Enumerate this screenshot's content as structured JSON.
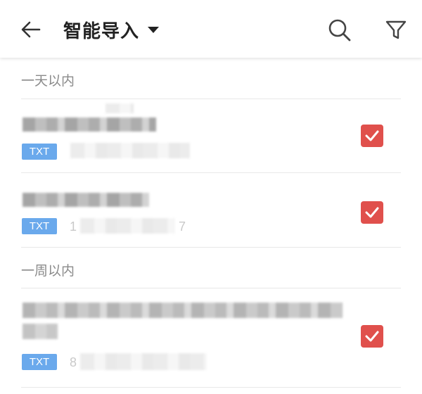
{
  "toolbar": {
    "back_icon": "arrow-left-icon",
    "title": "智能导入",
    "title_dropdown_icon": "caret-down-icon",
    "search_icon": "search-icon",
    "filter_icon": "filter-icon"
  },
  "sections": [
    {
      "header": "一天以内",
      "items": [
        {
          "badge": "TXT",
          "meta": "",
          "checked": true
        },
        {
          "badge": "TXT",
          "meta_start": "1",
          "meta_end": "7",
          "checked": true
        }
      ]
    },
    {
      "header": "一周以内",
      "items": [
        {
          "badge": "TXT",
          "meta_start": "8",
          "checked": true
        }
      ]
    }
  ],
  "colors": {
    "accent_checkbox": "#e0504c",
    "badge": "#6aa9ec",
    "section_header": "#8a8a8a"
  }
}
